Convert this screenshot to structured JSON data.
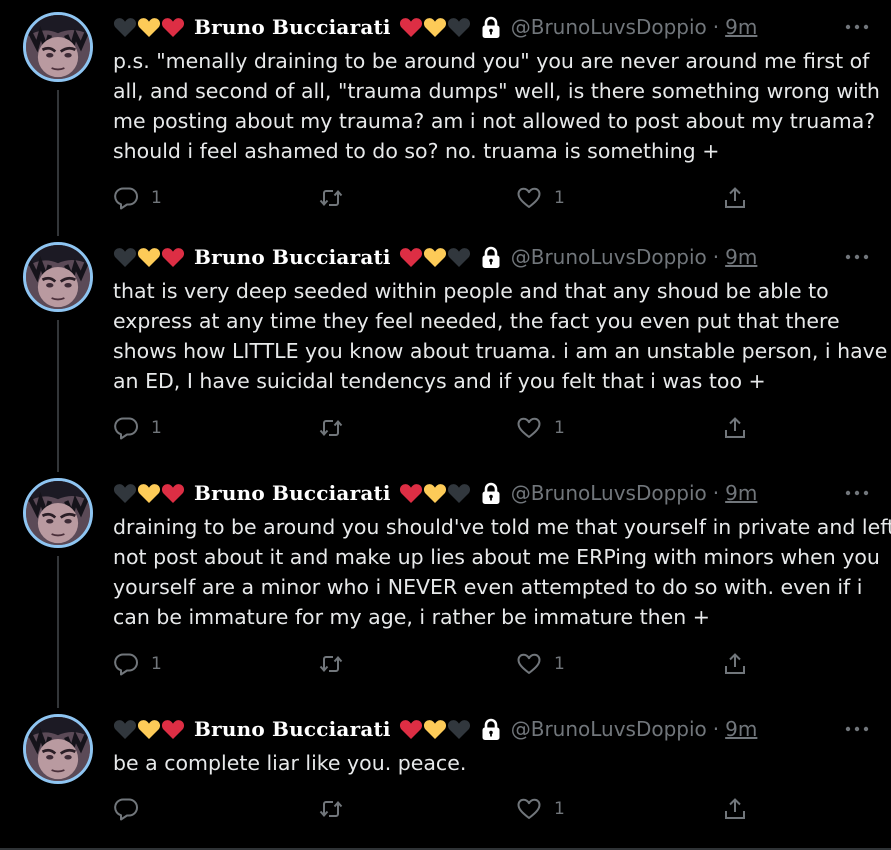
{
  "tweets": [
    {
      "display_name": "Bruno Bucciarati",
      "handle": "@BrunoLuvsDoppio",
      "time": "9m",
      "lines": [
        "p.s. \"menally draining to be around you\" you are never around me first of",
        "all, and second of all, \"trauma dumps\" well, is there something wrong with",
        "me posting about my trauma? am i not allowed to post about my truama?",
        "should i feel ashamed to do so? no. truama is something +"
      ],
      "reply_count": "1",
      "retweet_count": "",
      "like_count": "1"
    },
    {
      "display_name": "Bruno Bucciarati",
      "handle": "@BrunoLuvsDoppio",
      "time": "9m",
      "lines": [
        "that is very deep seeded within people and that any shoud be able to",
        "express at any time they feel needed, the fact you even put that there",
        "shows how LITTLE you know about truama. i am an unstable person, i have",
        "an ED, I have suicidal tendencys and if you felt that i was too +"
      ],
      "reply_count": "1",
      "retweet_count": "",
      "like_count": "1"
    },
    {
      "display_name": "Bruno Bucciarati",
      "handle": "@BrunoLuvsDoppio",
      "time": "9m",
      "lines": [
        "draining to be around you should've told me that yourself in private and left.",
        "not post about it and make up lies about me ERPing with minors when you",
        "yourself are a minor who i NEVER even attempted to do so with. even if i",
        "can be immature for my age, i rather be immature then +"
      ],
      "reply_count": "1",
      "retweet_count": "",
      "like_count": "1"
    },
    {
      "display_name": "Bruno Bucciarati",
      "handle": "@BrunoLuvsDoppio",
      "time": "9m",
      "lines": [
        "be a complete liar like you. peace."
      ],
      "reply_count": "",
      "retweet_count": "",
      "like_count": "1"
    }
  ],
  "separator": "·",
  "colors": {
    "background": "#000000",
    "text": "#e7e9ea",
    "muted": "#71767b",
    "heart_black": "#31373d",
    "heart_yellow": "#fdcb58",
    "heart_red": "#dd2e44",
    "avatar_ring": "#8ec5f2"
  },
  "icons": {
    "name_decorations_left": [
      "black-heart-icon",
      "yellow-heart-icon",
      "red-heart-icon"
    ],
    "name_decorations_right": [
      "red-heart-icon",
      "yellow-heart-icon",
      "black-heart-icon"
    ],
    "protected": "lock-icon",
    "more": "more-icon",
    "actions": [
      "reply-icon",
      "retweet-icon",
      "like-icon",
      "share-icon"
    ]
  }
}
